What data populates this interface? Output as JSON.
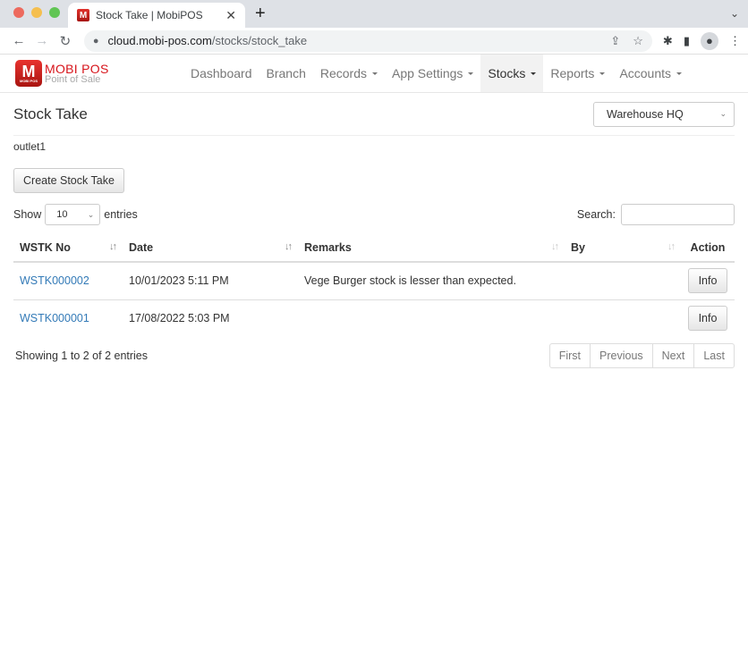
{
  "browser": {
    "tab_title": "Stock Take | MobiPOS",
    "favicon_letter": "M",
    "url_host": "cloud.mobi-pos.com",
    "url_path": "/stocks/stock_take",
    "icons": {
      "back": "←",
      "forward": "→",
      "reload": "↻",
      "lock": "🔒",
      "share": "⇪",
      "star": "☆",
      "extensions": "✱",
      "sidepanel": "▮",
      "profile": "👤",
      "menu": "⋮",
      "close": "✕",
      "new_tab": "+",
      "tab_menu": "⌄"
    }
  },
  "navbar": {
    "brand_name": "MOBI POS",
    "brand_sub": "Point of Sale",
    "logo_letter": "M",
    "logo_small": "MOBI POS",
    "items": [
      {
        "label": "Dashboard",
        "dropdown": false,
        "active": false
      },
      {
        "label": "Branch",
        "dropdown": false,
        "active": false
      },
      {
        "label": "Records",
        "dropdown": true,
        "active": false
      },
      {
        "label": "App Settings",
        "dropdown": true,
        "active": false
      },
      {
        "label": "Stocks",
        "dropdown": true,
        "active": true
      },
      {
        "label": "Reports",
        "dropdown": true,
        "active": false
      },
      {
        "label": "Accounts",
        "dropdown": true,
        "active": false
      }
    ]
  },
  "page": {
    "title": "Stock Take",
    "warehouse_select": "Warehouse HQ",
    "outlet": "outlet1",
    "create_button": "Create Stock Take"
  },
  "table_controls": {
    "show_label": "Show",
    "entries_label": "entries",
    "page_length": "10",
    "search_label": "Search:",
    "search_value": "",
    "chevron": "⌄"
  },
  "table": {
    "columns": [
      "WSTK No",
      "Date",
      "Remarks",
      "By",
      "Action"
    ],
    "sort_icon": "↓↑",
    "rows": [
      {
        "no": "WSTK000002",
        "date": "10/01/2023 5:11 PM",
        "remarks": "Vege Burger stock is lesser than expected.",
        "by": "",
        "action": "Info"
      },
      {
        "no": "WSTK000001",
        "date": "17/08/2022 5:03 PM",
        "remarks": "",
        "by": "",
        "action": "Info"
      }
    ]
  },
  "footer": {
    "info": "Showing 1 to 2 of 2 entries",
    "pager": [
      "First",
      "Previous",
      "Next",
      "Last"
    ]
  }
}
